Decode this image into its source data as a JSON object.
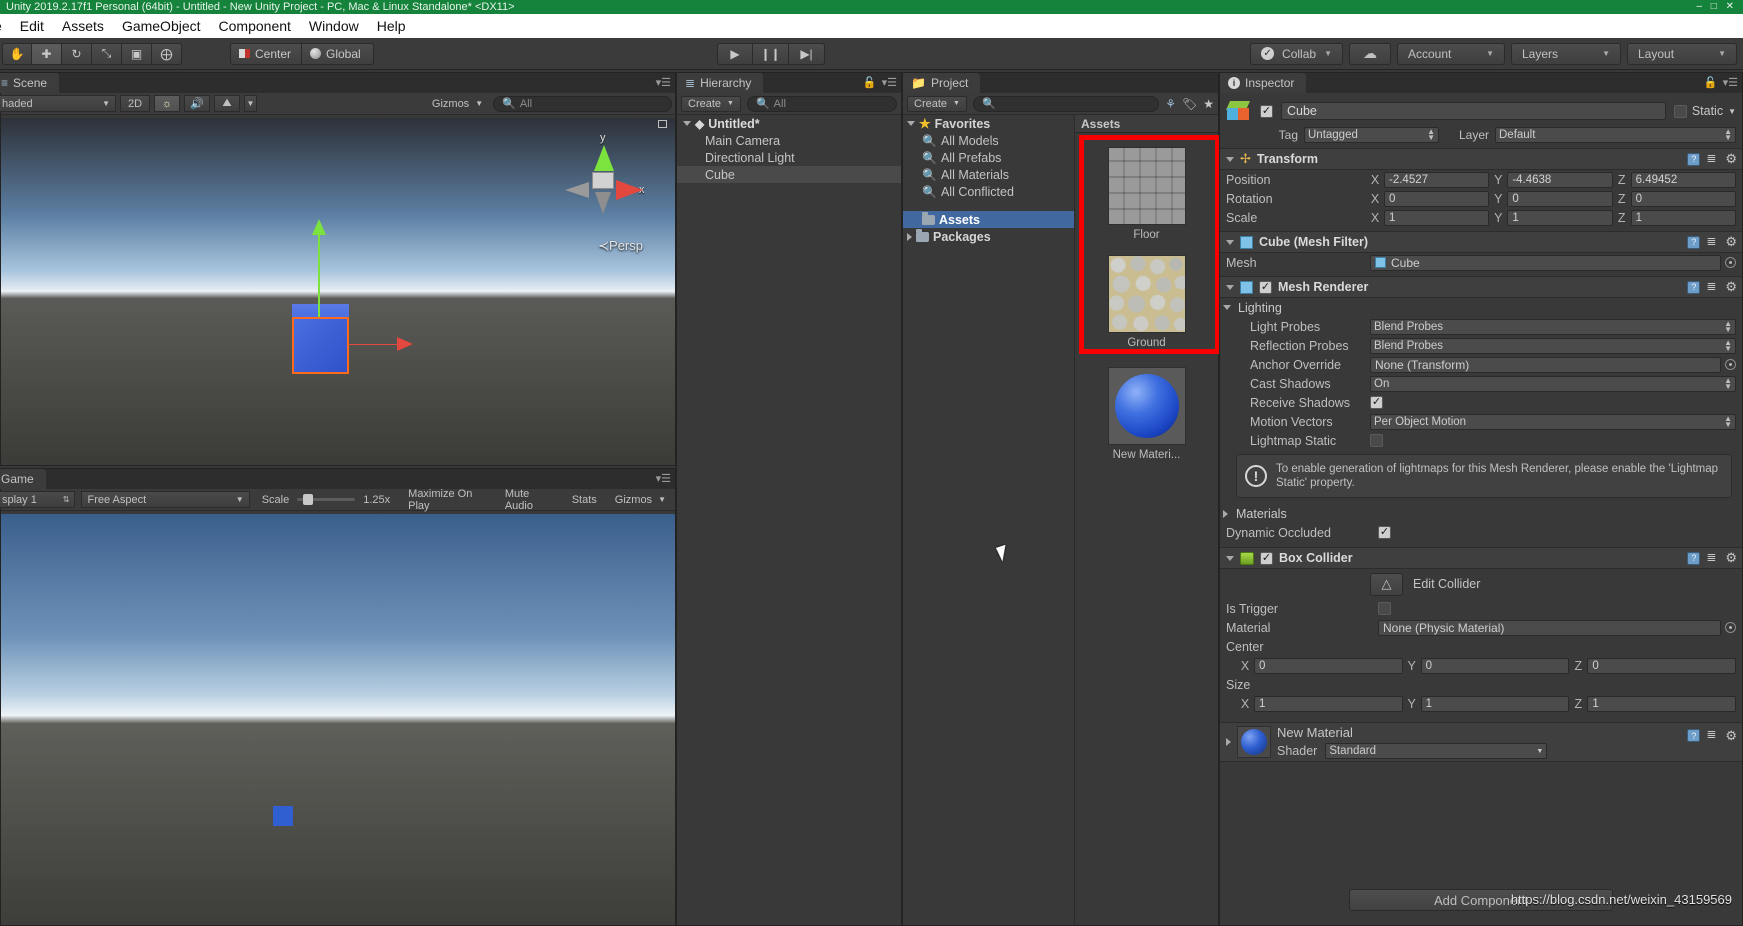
{
  "window": {
    "title": "Unity 2019.2.17f1 Personal (64bit) - Untitled - New Unity Project - PC, Mac & Linux Standalone* <DX11>",
    "controls": "– □ ✕"
  },
  "menu": {
    "items": [
      "e",
      "Edit",
      "Assets",
      "GameObject",
      "Component",
      "Window",
      "Help"
    ]
  },
  "toolbar": {
    "transform_tools": [
      {
        "name": "hand-tool",
        "glyph": "✋"
      },
      {
        "name": "move-tool",
        "glyph": "✚"
      },
      {
        "name": "rotate-tool",
        "glyph": "↻"
      },
      {
        "name": "scale-tool",
        "glyph": "⤡"
      },
      {
        "name": "rect-tool",
        "glyph": "▣"
      },
      {
        "name": "transform-tool",
        "glyph": "⨁"
      }
    ],
    "pivot_mode": "Center",
    "pivot_rotation": "Global",
    "play": "▶",
    "pause": "❙❙",
    "step": "▶|",
    "collab": "Collab",
    "cloud": "☁",
    "account": "Account",
    "layers": "Layers",
    "layout": "Layout"
  },
  "scene": {
    "tab": "Scene",
    "draw_mode": "haded",
    "mode_2d": "2D",
    "lighting_icon": "sun-icon",
    "audio_icon": "speaker-icon",
    "fx_icon": "image-icon",
    "gizmos": "Gizmos",
    "search_placeholder": "All",
    "persp_label": "Persp",
    "axis_y": "y",
    "axis_x": "x"
  },
  "game": {
    "tab": "Game",
    "display": "splay 1",
    "aspect": "Free Aspect",
    "scale_label": "Scale",
    "scale_value": "1.25x",
    "maximize": "Maximize On Play",
    "mute": "Mute Audio",
    "stats": "Stats",
    "gizmos": "Gizmos"
  },
  "hierarchy": {
    "tab": "Hierarchy",
    "create": "Create",
    "search_placeholder": "All",
    "scene_name": "Untitled*",
    "objects": [
      {
        "label": "Main Camera",
        "selected": false
      },
      {
        "label": "Directional Light",
        "selected": false
      },
      {
        "label": "Cube",
        "selected": true
      }
    ]
  },
  "project": {
    "tab": "Project",
    "create": "Create",
    "search_placeholder": "",
    "tree": [
      {
        "label": "Favorites",
        "icon": "star-icon",
        "type": "root"
      },
      {
        "label": "All Models",
        "icon": "search-icon",
        "type": "favorite"
      },
      {
        "label": "All Prefabs",
        "icon": "search-icon",
        "type": "favorite"
      },
      {
        "label": "All Materials",
        "icon": "search-icon",
        "type": "favorite"
      },
      {
        "label": "All Conflicted",
        "icon": "search-icon",
        "type": "favorite"
      },
      {
        "label": "Assets",
        "icon": "folder-icon",
        "type": "folder",
        "selected": true
      },
      {
        "label": "Packages",
        "icon": "folder-icon",
        "type": "folder",
        "selected": false
      }
    ],
    "assets_header": "Assets",
    "assets": [
      {
        "label": "Floor",
        "thumb": "tile-texture",
        "highlighted": true
      },
      {
        "label": "Ground",
        "thumb": "cobble-texture",
        "highlighted": true
      },
      {
        "label": "New Materi...",
        "thumb": "blue-sphere",
        "highlighted": false
      }
    ],
    "highlight_color": "#f90000"
  },
  "inspector": {
    "tab": "Inspector",
    "object_name": "Cube",
    "object_enabled": true,
    "static_label": "Static",
    "static_checked": false,
    "tag_label": "Tag",
    "tag_value": "Untagged",
    "layer_label": "Layer",
    "layer_value": "Default",
    "transform": {
      "title": "Transform",
      "rows": [
        {
          "label": "Position",
          "x": "-2.4527",
          "y": "-4.4638",
          "z": "6.49452"
        },
        {
          "label": "Rotation",
          "x": "0",
          "y": "0",
          "z": "0"
        },
        {
          "label": "Scale",
          "x": "1",
          "y": "1",
          "z": "1"
        }
      ]
    },
    "mesh_filter": {
      "title": "Cube (Mesh Filter)",
      "mesh_label": "Mesh",
      "mesh_value": "Cube"
    },
    "mesh_renderer": {
      "title": "Mesh Renderer",
      "enabled": true,
      "lighting_label": "Lighting",
      "light_probes_label": "Light Probes",
      "light_probes_value": "Blend Probes",
      "reflection_probes_label": "Reflection Probes",
      "reflection_probes_value": "Blend Probes",
      "anchor_override_label": "Anchor Override",
      "anchor_override_value": "None (Transform)",
      "cast_shadows_label": "Cast Shadows",
      "cast_shadows_value": "On",
      "receive_shadows_label": "Receive Shadows",
      "receive_shadows_checked": true,
      "motion_vectors_label": "Motion Vectors",
      "motion_vectors_value": "Per Object Motion",
      "lightmap_static_label": "Lightmap Static",
      "lightmap_static_checked": false,
      "help_text": "To enable generation of lightmaps for this Mesh Renderer, please enable the 'Lightmap Static' property.",
      "materials_label": "Materials",
      "dynamic_occluded_label": "Dynamic Occluded",
      "dynamic_occluded_checked": true
    },
    "box_collider": {
      "title": "Box Collider",
      "enabled": true,
      "edit_collider_label": "Edit Collider",
      "is_trigger_label": "Is Trigger",
      "is_trigger_checked": false,
      "material_label": "Material",
      "material_value": "None (Physic Material)",
      "center_label": "Center",
      "center": {
        "x": "0",
        "y": "0",
        "z": "0"
      },
      "size_label": "Size",
      "size": {
        "x": "1",
        "y": "1",
        "z": "1"
      }
    },
    "material": {
      "title": "New Material",
      "shader_label": "Shader",
      "shader_value": "Standard"
    },
    "add_component": "Add Component"
  },
  "watermark": "https://blog.csdn.net/weixin_43159569"
}
